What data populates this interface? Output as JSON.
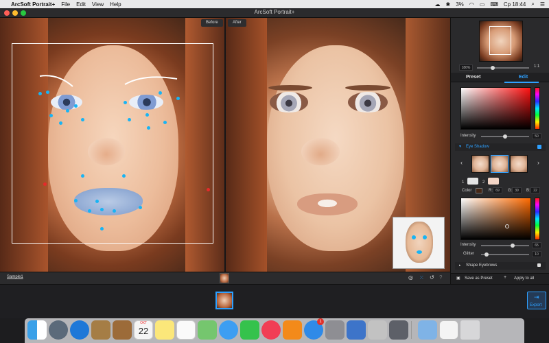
{
  "menubar": {
    "app_name": "ArcSoft Portrait+",
    "menus": [
      "File",
      "Edit",
      "View",
      "Help"
    ],
    "battery_percent": "3%",
    "clock": "Ср 18:44"
  },
  "window": {
    "title": "ArcSoft Portrait+"
  },
  "canvas": {
    "before_label": "Before",
    "after_label": "After"
  },
  "navigator": {
    "zoom_value": "186%",
    "fit_label": "1:1"
  },
  "tabs": {
    "preset": "Preset",
    "edit": "Edit"
  },
  "makeup": {
    "intensity_label": "Intensity",
    "intensity_value": "50",
    "intensity_fraction": 0.5,
    "section_title": "Eye Shadow",
    "layer_1": "1",
    "layer_2": "2",
    "color_label": "Color",
    "r_label": "R:",
    "r_value": "69",
    "g_label": "G:",
    "g_value": "39",
    "b_label": "B:",
    "b_value": "22",
    "intensity2_label": "Intensity",
    "intensity2_value": "65",
    "intensity2_fraction": 0.65,
    "glitter_label": "Glitter",
    "glitter_value": "10",
    "glitter_fraction": 0.1,
    "shape_eyebrows": "Shape Eyebrows"
  },
  "actions": {
    "save_preset": "Save as Preset",
    "apply_all": "Apply to all",
    "export": "Export"
  },
  "footer": {
    "sample_name": "Sample1"
  },
  "dock": {
    "calendar_month": "ОКТ",
    "calendar_day": "22",
    "appstore_badge": "1"
  }
}
